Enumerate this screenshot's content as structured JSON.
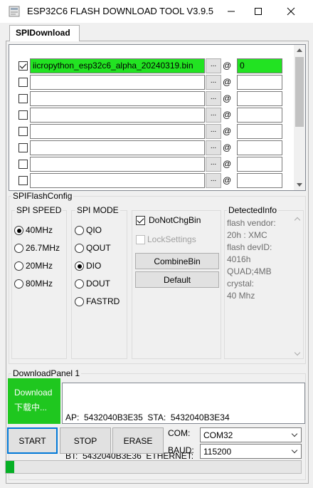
{
  "window": {
    "title": "ESP32C6 FLASH DOWNLOAD TOOL V3.9.5",
    "minimize_glyph": "—",
    "maximize_glyph": "☐",
    "close_glyph": "✕"
  },
  "tabs": [
    {
      "label": "SPIDownload",
      "active": true
    }
  ],
  "file_list": {
    "rows": [
      {
        "checked": true,
        "path": "iicropython_esp32c6_alpha_20240319.bin",
        "browse": "...",
        "at": "@",
        "address": "0",
        "highlight": true
      },
      {
        "checked": false,
        "path": "",
        "browse": "...",
        "at": "@",
        "address": "",
        "highlight": false
      },
      {
        "checked": false,
        "path": "",
        "browse": "...",
        "at": "@",
        "address": "",
        "highlight": false
      },
      {
        "checked": false,
        "path": "",
        "browse": "...",
        "at": "@",
        "address": "",
        "highlight": false
      },
      {
        "checked": false,
        "path": "",
        "browse": "...",
        "at": "@",
        "address": "",
        "highlight": false
      },
      {
        "checked": false,
        "path": "",
        "browse": "...",
        "at": "@",
        "address": "",
        "highlight": false
      },
      {
        "checked": false,
        "path": "",
        "browse": "...",
        "at": "@",
        "address": "",
        "highlight": false
      },
      {
        "checked": false,
        "path": "",
        "browse": "...",
        "at": "@",
        "address": "",
        "highlight": false
      }
    ],
    "highlight_color": "#22e322"
  },
  "spi_flash_config": {
    "label": "SPIFlashConfig",
    "spi_speed": {
      "label": "SPI SPEED",
      "options": [
        "40MHz",
        "26.7MHz",
        "20MHz",
        "80MHz"
      ],
      "selected": "40MHz"
    },
    "spi_mode": {
      "label": "SPI MODE",
      "options": [
        "QIO",
        "QOUT",
        "DIO",
        "DOUT",
        "FASTRD"
      ],
      "selected": "DIO"
    },
    "do_not_chg_bin": {
      "label": "DoNotChgBin",
      "checked": true
    },
    "lock_settings": {
      "label": "LockSettings",
      "checked": false,
      "disabled": true
    },
    "combine_bin_label": "CombineBin",
    "default_label": "Default",
    "detected_info": {
      "label": "DetectedInfo",
      "text": "flash vendor:\n20h : XMC\nflash devID:\n4016h\nQUAD;4MB\ncrystal:\n40 Mhz"
    }
  },
  "download_panel": {
    "label": "DownloadPanel 1",
    "status_line1": "Download",
    "status_line2": "下载中...",
    "status_color": "#1fc71f",
    "info_line1": "AP:  5432040B3E35  STA:  5432040B3E34",
    "info_line2": "BT:  5432040B3E36  ETHERNET:",
    "start_label": "START",
    "stop_label": "STOP",
    "erase_label": "ERASE",
    "com_label": "COM:",
    "com_value": "COM32",
    "baud_label": "BAUD:",
    "baud_value": "115200",
    "progress": 0.03,
    "progress_color": "#06b025"
  }
}
